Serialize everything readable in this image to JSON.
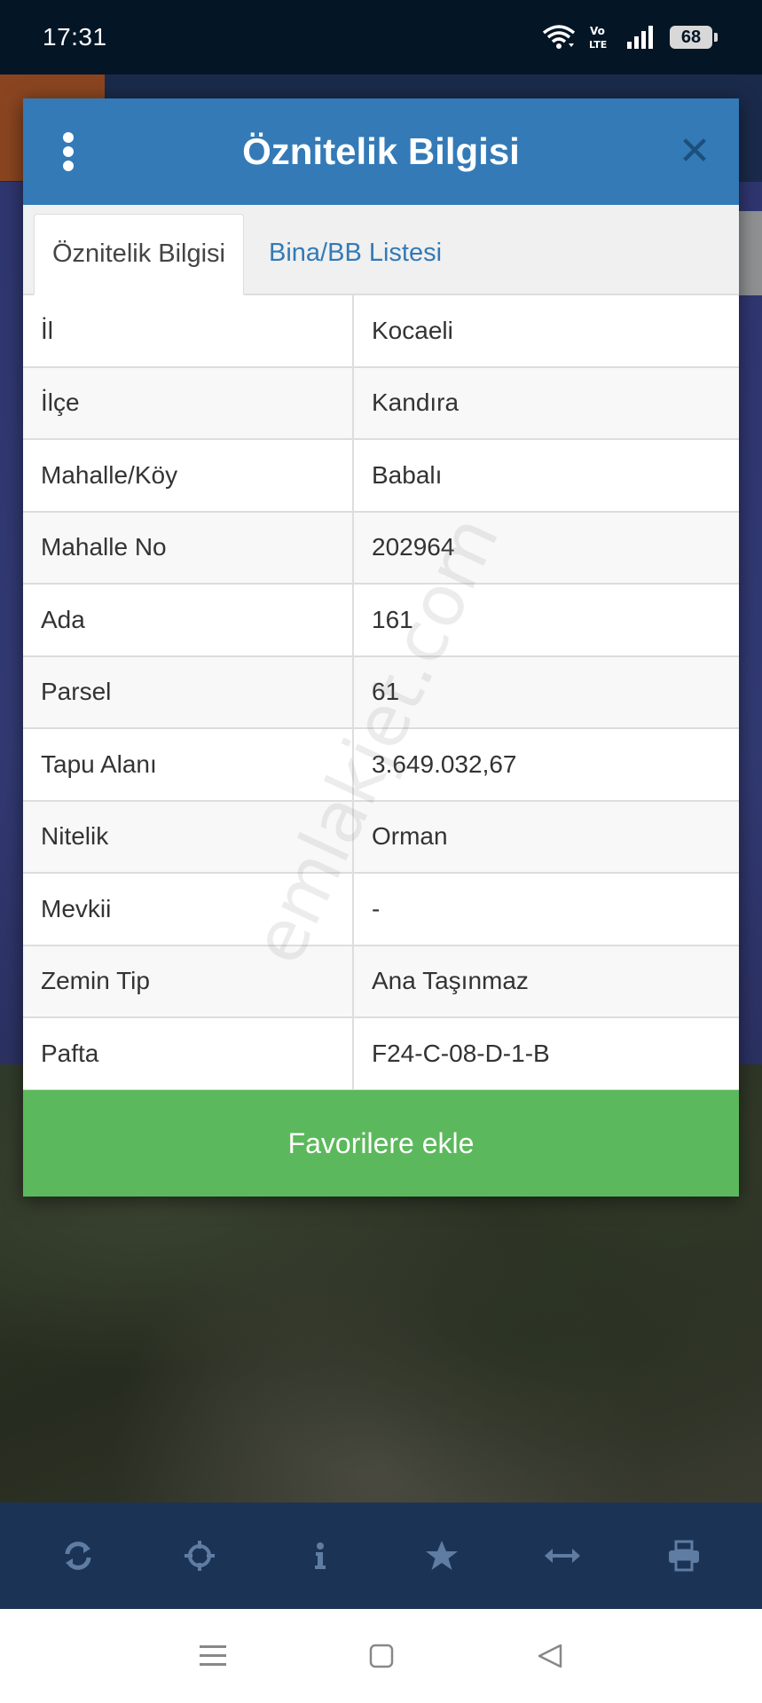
{
  "status_bar": {
    "time": "17:31",
    "battery": "68",
    "icons": [
      "wifi-icon",
      "volte-icon",
      "signal-icon",
      "battery-icon"
    ]
  },
  "modal": {
    "title": "Öznitelik Bilgisi",
    "menu_icon": "vertical-dots-icon",
    "close_label": "✕",
    "tabs": [
      {
        "label": "Öznitelik Bilgisi",
        "active": true
      },
      {
        "label": "Bina/BB Listesi",
        "active": false
      }
    ],
    "rows": [
      {
        "key": "İl",
        "value": "Kocaeli"
      },
      {
        "key": "İlçe",
        "value": "Kandıra"
      },
      {
        "key": "Mahalle/Köy",
        "value": "Babalı"
      },
      {
        "key": "Mahalle No",
        "value": "202964"
      },
      {
        "key": "Ada",
        "value": "161"
      },
      {
        "key": "Parsel",
        "value": "61"
      },
      {
        "key": "Tapu Alanı",
        "value": "3.649.032,67"
      },
      {
        "key": "Nitelik",
        "value": "Orman"
      },
      {
        "key": "Mevkii",
        "value": "-"
      },
      {
        "key": "Zemin Tip",
        "value": "Ana Taşınmaz"
      },
      {
        "key": "Pafta",
        "value": "F24-C-08-D-1-B"
      }
    ],
    "favorite_button": "Favorilere ekle"
  },
  "watermark": "emlakjet.com",
  "toolbar": {
    "items": [
      "refresh-icon",
      "crosshair-icon",
      "info-icon",
      "star-icon",
      "measure-icon",
      "print-icon"
    ]
  },
  "navbar": {
    "items": [
      "recents-icon",
      "home-icon",
      "back-icon"
    ]
  },
  "colors": {
    "header": "#337ab7",
    "favorite": "#5cb85c",
    "toolbar": "#1b3455",
    "status_bar": "#041526"
  }
}
